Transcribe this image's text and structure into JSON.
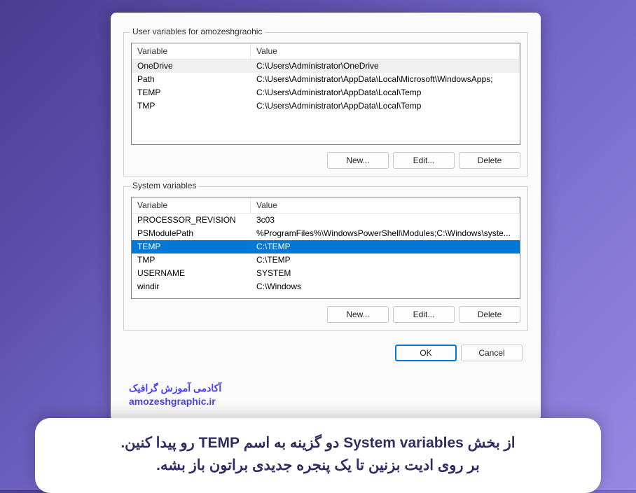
{
  "user_section": {
    "title": "User variables for amozeshgraohic",
    "headers": {
      "variable": "Variable",
      "value": "Value"
    },
    "rows": [
      {
        "variable": "OneDrive",
        "value": "C:\\Users\\Administrator\\OneDrive",
        "selected": true
      },
      {
        "variable": "Path",
        "value": "C:\\Users\\Administrator\\AppData\\Local\\Microsoft\\WindowsApps;"
      },
      {
        "variable": "TEMP",
        "value": "C:\\Users\\Administrator\\AppData\\Local\\Temp"
      },
      {
        "variable": "TMP",
        "value": "C:\\Users\\Administrator\\AppData\\Local\\Temp"
      }
    ],
    "buttons": {
      "new": "New...",
      "edit": "Edit...",
      "delete": "Delete"
    }
  },
  "system_section": {
    "title": "System variables",
    "headers": {
      "variable": "Variable",
      "value": "Value"
    },
    "rows": [
      {
        "variable": "PROCESSOR_REVISION",
        "value": "3c03"
      },
      {
        "variable": "PSModulePath",
        "value": "%ProgramFiles%\\WindowsPowerShell\\Modules;C:\\Windows\\syste..."
      },
      {
        "variable": "TEMP",
        "value": "C:\\TEMP",
        "selected": true
      },
      {
        "variable": "TMP",
        "value": "C:\\TEMP"
      },
      {
        "variable": "USERNAME",
        "value": "SYSTEM"
      },
      {
        "variable": "windir",
        "value": "C:\\Windows"
      }
    ],
    "buttons": {
      "new": "New...",
      "edit": "Edit...",
      "delete": "Delete"
    }
  },
  "dialog_buttons": {
    "ok": "OK",
    "cancel": "Cancel"
  },
  "watermark": {
    "text": "آکادمی آموزش گرافیک",
    "url": "amozeshgraphic.ir"
  },
  "caption": {
    "line1": "از بخش System variables دو گزینه به اسم TEMP رو پیدا کنین.",
    "line2": "بر روی ادیت بزنین تا یک پنجره جدیدی براتون باز بشه."
  }
}
